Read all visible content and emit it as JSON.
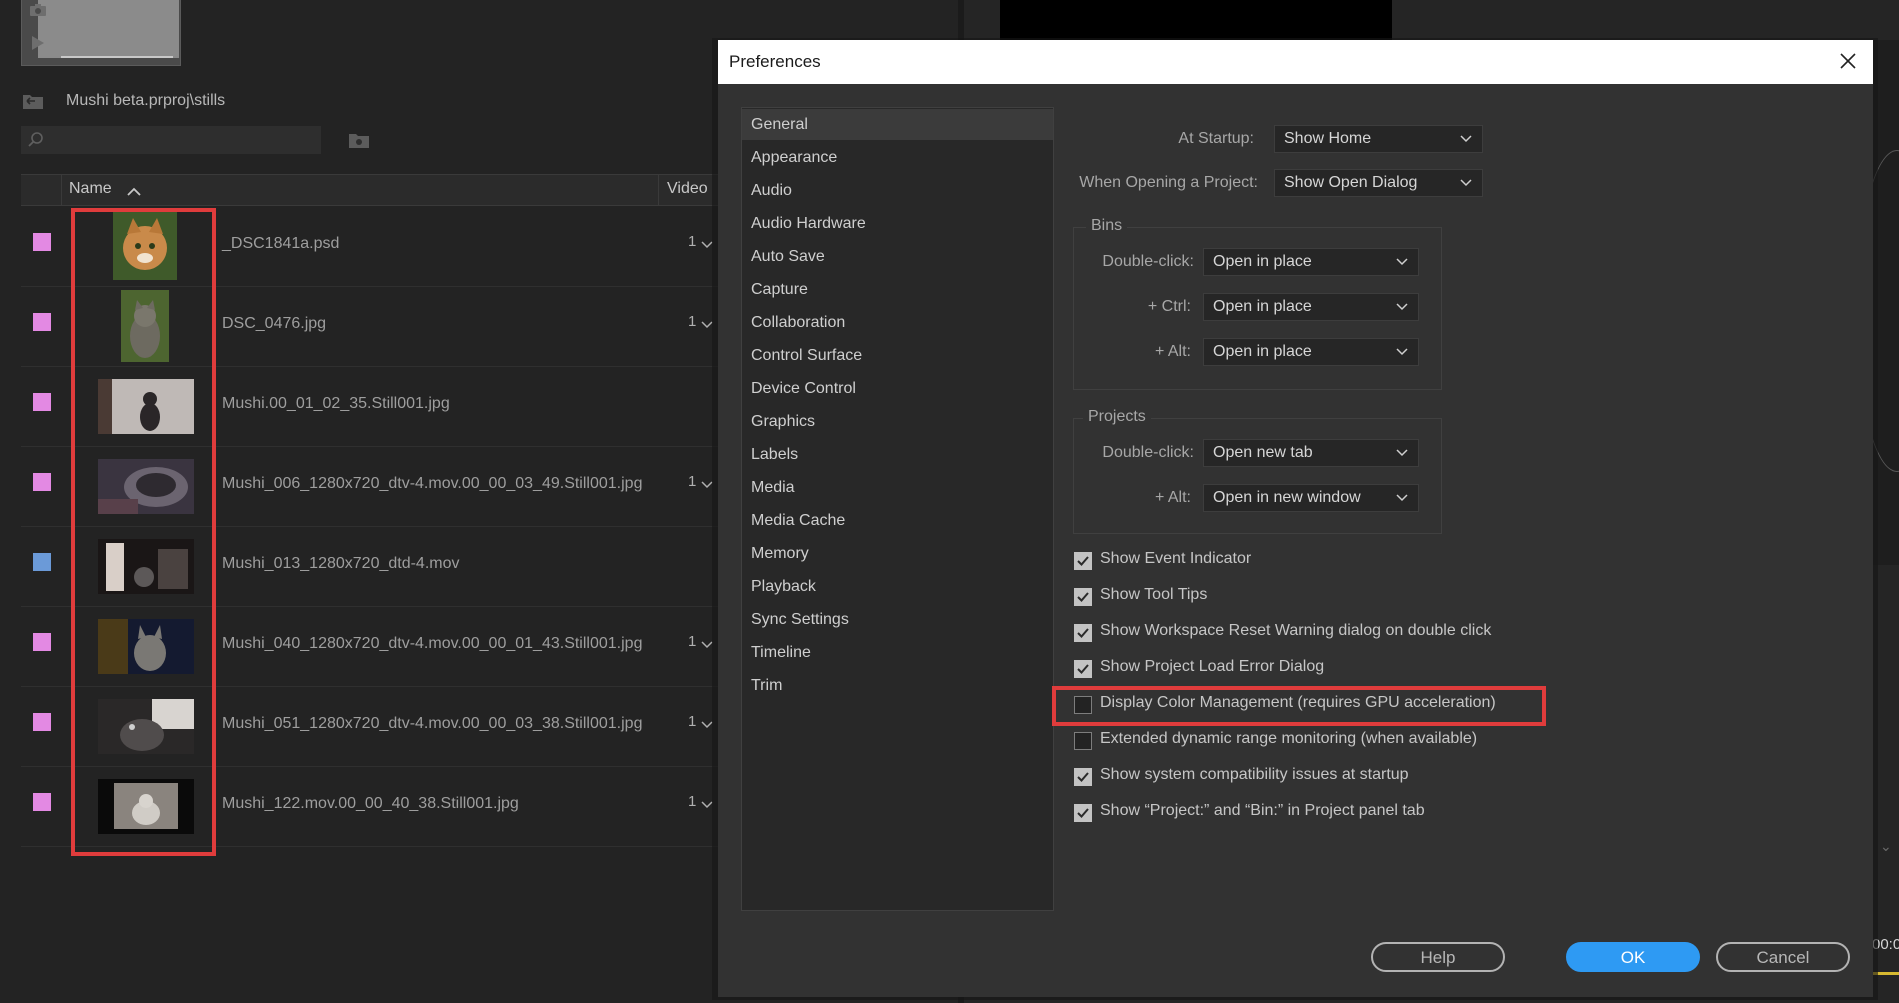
{
  "project_panel": {
    "bin_path": "Mushi beta.prproj\\stills",
    "columns": {
      "name": "Name",
      "video": "Video"
    },
    "items": [
      {
        "name": "_DSC1841a.psd",
        "video": "1",
        "swatch": "#e389e3",
        "thumb": "cat-portrait-orange"
      },
      {
        "name": "DSC_0476.jpg",
        "video": "1",
        "swatch": "#e389e3",
        "thumb": "cat-portrait-grey"
      },
      {
        "name": "Mushi.00_01_02_35.Still001.jpg",
        "video": "",
        "swatch": "#e389e3",
        "thumb": "cat-sitting"
      },
      {
        "name": "Mushi_006_1280x720_dtv-4.mov.00_00_03_49.Still001.jpg",
        "video": "1",
        "swatch": "#e389e3",
        "thumb": "cat-bed"
      },
      {
        "name": "Mushi_013_1280x720_dtd-4.mov",
        "video": "",
        "swatch": "#6b9ad8",
        "thumb": "cat-doorway"
      },
      {
        "name": "Mushi_040_1280x720_dtv-4.mov.00_00_01_43.Still001.jpg",
        "video": "1",
        "swatch": "#e389e3",
        "thumb": "cat-closeup"
      },
      {
        "name": "Mushi_051_1280x720_dtv-4.mov.00_00_03_38.Still001.jpg",
        "video": "1",
        "swatch": "#e389e3",
        "thumb": "cat-dark"
      },
      {
        "name": "Mushi_122.mov.00_00_40_38.Still001.jpg",
        "video": "1",
        "swatch": "#e389e3",
        "thumb": "cat-window"
      }
    ]
  },
  "monitor": {
    "timecode": "00:0"
  },
  "dialog": {
    "title": "Preferences",
    "categories": [
      "General",
      "Appearance",
      "Audio",
      "Audio Hardware",
      "Auto Save",
      "Capture",
      "Collaboration",
      "Control Surface",
      "Device Control",
      "Graphics",
      "Labels",
      "Media",
      "Media Cache",
      "Memory",
      "Playback",
      "Sync Settings",
      "Timeline",
      "Trim"
    ],
    "selected_category": "General",
    "at_startup": {
      "label": "At Startup:",
      "value": "Show Home"
    },
    "when_opening": {
      "label": "When Opening a Project:",
      "value": "Show Open Dialog"
    },
    "bins": {
      "title": "Bins",
      "double_click": {
        "label": "Double-click:",
        "value": "Open in place"
      },
      "ctrl": {
        "label": "+ Ctrl:",
        "value": "Open in place"
      },
      "alt": {
        "label": "+ Alt:",
        "value": "Open in place"
      }
    },
    "projects": {
      "title": "Projects",
      "double_click": {
        "label": "Double-click:",
        "value": "Open new tab"
      },
      "alt": {
        "label": "+ Alt:",
        "value": "Open in new window"
      }
    },
    "checkboxes": [
      {
        "label": "Show Event Indicator",
        "checked": true
      },
      {
        "label": "Show Tool Tips",
        "checked": true
      },
      {
        "label": "Show Workspace Reset Warning dialog on double click",
        "checked": true
      },
      {
        "label": "Show Project Load Error Dialog",
        "checked": true
      },
      {
        "label": "Display Color Management (requires GPU acceleration)",
        "checked": false
      },
      {
        "label": "Extended dynamic range monitoring (when available)",
        "checked": false
      },
      {
        "label": "Show system compatibility issues at startup",
        "checked": true
      },
      {
        "label": "Show “Project:” and “Bin:” in Project panel tab",
        "checked": true
      }
    ],
    "buttons": {
      "help": "Help",
      "ok": "OK",
      "cancel": "Cancel"
    },
    "colors": {
      "accent": "#2e9af3",
      "highlight": "#e03c3c"
    }
  }
}
